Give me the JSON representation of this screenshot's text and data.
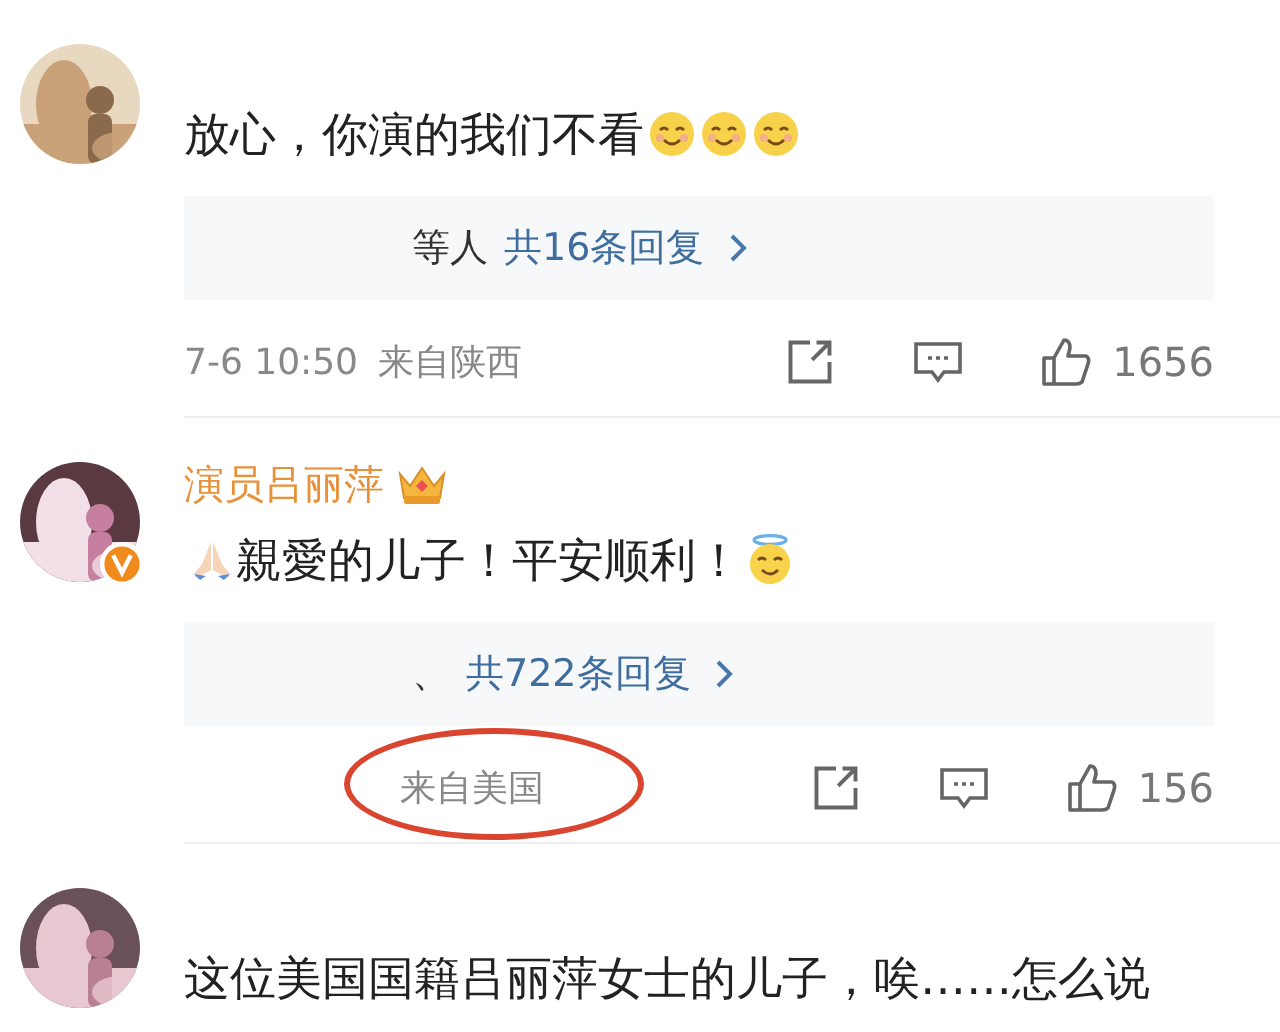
{
  "comments": [
    {
      "verified": false,
      "text": "放心，你演的我们不看",
      "emojis": [
        {
          "kind": "smile"
        },
        {
          "kind": "smile"
        },
        {
          "kind": "smile"
        }
      ],
      "replies": {
        "preview": "等人",
        "count": "共16条回复"
      },
      "time": "7-6 10:50",
      "location": "来自陕西",
      "location_circled": false,
      "likes": "1656"
    },
    {
      "author": "演员吕丽萍",
      "author_badge": {
        "kind": "crown"
      },
      "verified": true,
      "lead_emoji": {
        "kind": "pray"
      },
      "text": "親愛的儿子！平安顺利！",
      "emojis": [
        {
          "kind": "halo"
        }
      ],
      "replies": {
        "preview": "、",
        "count": "共722条回复"
      },
      "location": "来自美国",
      "location_circled": true,
      "likes": "156"
    },
    {
      "verified": false,
      "text": "这位美国国籍吕丽萍女士的儿子，唉……怎么说"
    }
  ]
}
